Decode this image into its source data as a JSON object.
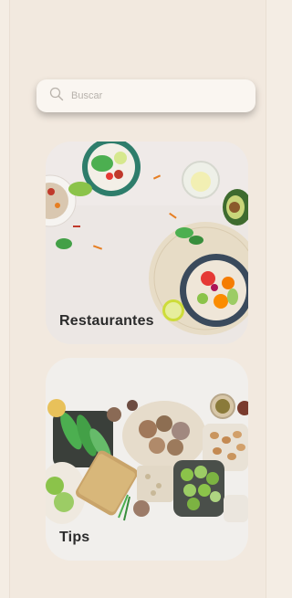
{
  "search": {
    "placeholder": "Buscar",
    "icon": "search-icon"
  },
  "cards": [
    {
      "title": "Restaurantes",
      "image": "food-bowls-photo"
    },
    {
      "title": "Tips",
      "image": "groceries-photo"
    }
  ],
  "colors": {
    "page_background": "#f2e9df",
    "search_background": "#faf6f1",
    "title_text": "#2b2b2b"
  }
}
